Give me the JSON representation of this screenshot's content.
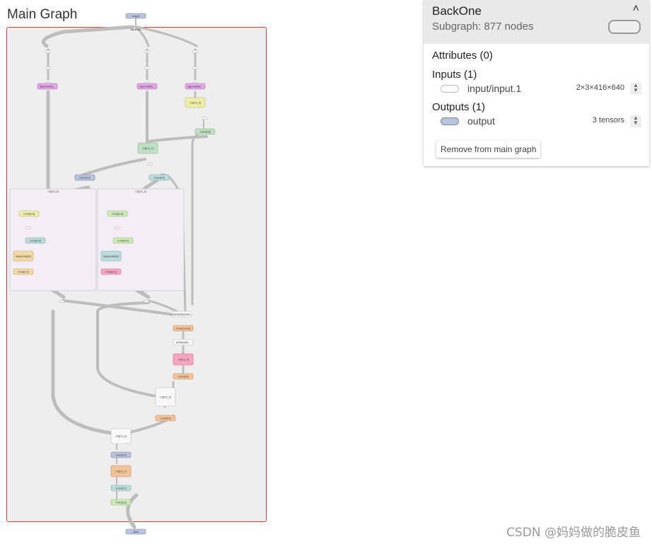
{
  "main_title": "Main Graph",
  "graph": {
    "top_node": "output",
    "bottom_node": "input",
    "subgraph_label": "BackOne",
    "colors": {
      "selection_border": "#e53935",
      "edge": "#bdbdbd",
      "blue": "#b8c4dd",
      "pink": "#e3a8e6",
      "yellow": "#eeeeaa",
      "green": "#bfe0c2",
      "teal": "#bcdcdc",
      "lightgreen": "#cfe8b8",
      "orange": "#f1c39c",
      "sand": "#f2d9a6",
      "rose": "#f4a6c0",
      "white": "#f8f8f8"
    },
    "nodes": [
      {
        "id": "n-output",
        "label": "output",
        "color": "blue"
      },
      {
        "id": "n-out1",
        "label": "Sigmoid/Mu...",
        "color": "pink"
      },
      {
        "id": "n-out2",
        "label": "Sigmoid/Mu...",
        "color": "pink"
      },
      {
        "id": "n-out3",
        "label": "Sigmoid/Mu...",
        "color": "pink"
      },
      {
        "id": "n-c3a",
        "label": "C3[C3_8]",
        "color": "yellow"
      },
      {
        "id": "n-conv6",
        "label": "Conv[C6]",
        "color": "green"
      },
      {
        "id": "n-c3b",
        "label": "C3[C3_7]",
        "color": "green"
      },
      {
        "id": "n-conv7",
        "label": "Conv[C7]",
        "color": "blue"
      },
      {
        "id": "n-conv5",
        "label": "Conv[C5]",
        "color": "teal"
      },
      {
        "id": "n-c34",
        "label": "C3[C3_4]",
        "color": "none"
      },
      {
        "id": "n-c33",
        "label": "C3[C3_3]",
        "color": "none"
      },
      {
        "id": "n-l-cv3",
        "label": "Conv[cv3]",
        "color": "yellow"
      },
      {
        "id": "n-l-cv2",
        "label": "Conv[cv2]",
        "color": "teal"
      },
      {
        "id": "n-l-seq",
        "label": "Sequential[m]",
        "color": "sand"
      },
      {
        "id": "n-l-cv1",
        "label": "Conv[cv1]",
        "color": "sand"
      },
      {
        "id": "n-r-cv3",
        "label": "Conv[cv3]",
        "color": "lightgreen"
      },
      {
        "id": "n-r-cv2",
        "label": "Conv[cv2]",
        "color": "lightgreen"
      },
      {
        "id": "n-r-seq",
        "label": "Sequential[m]",
        "color": "teal"
      },
      {
        "id": "n-r-cv1",
        "label": "Conv[cv1]",
        "color": "rose"
      },
      {
        "id": "n-upsample",
        "label": "Upsample[upsam...",
        "color": "white"
      },
      {
        "id": "n-convconv",
        "label": "Conv[Conv1]",
        "color": "orange"
      },
      {
        "id": "n-sppf",
        "label": "SPPF[SPP...",
        "color": "white"
      },
      {
        "id": "n-c3c",
        "label": "C3[C3_4]",
        "color": "rose"
      },
      {
        "id": "n-conv4",
        "label": "Conv[C4]",
        "color": "orange"
      },
      {
        "id": "n-c3d",
        "label": "C3[C3_3]",
        "color": "white"
      },
      {
        "id": "n-conv3",
        "label": "Conv[C4]",
        "color": "orange"
      },
      {
        "id": "n-c3e",
        "label": "C3[C3_2]",
        "color": "white"
      },
      {
        "id": "n-conv2",
        "label": "Conv[C3]",
        "color": "blue"
      },
      {
        "id": "n-c3f",
        "label": "C3[C3_1]",
        "color": "orange"
      },
      {
        "id": "n-conv1",
        "label": "Conv[C2]",
        "color": "teal"
      },
      {
        "id": "n-conv0",
        "label": "Conv[C1]",
        "color": "lightgreen"
      },
      {
        "id": "n-input",
        "label": "input",
        "color": "blue"
      }
    ]
  },
  "panel": {
    "title": "BackOne",
    "subtitle": "Subgraph: 877 nodes",
    "collapse_icon": "chevron-up-icon",
    "attributes_label": "Attributes (0)",
    "inputs_label": "Inputs (1)",
    "inputs": [
      {
        "name": "input/input.1",
        "value": "2×3×416×640"
      }
    ],
    "outputs_label": "Outputs (1)",
    "outputs": [
      {
        "name": "output",
        "value": "3 tensors"
      }
    ],
    "remove_button": "Remove from main graph"
  },
  "watermark": "CSDN @妈妈做的脆皮鱼"
}
